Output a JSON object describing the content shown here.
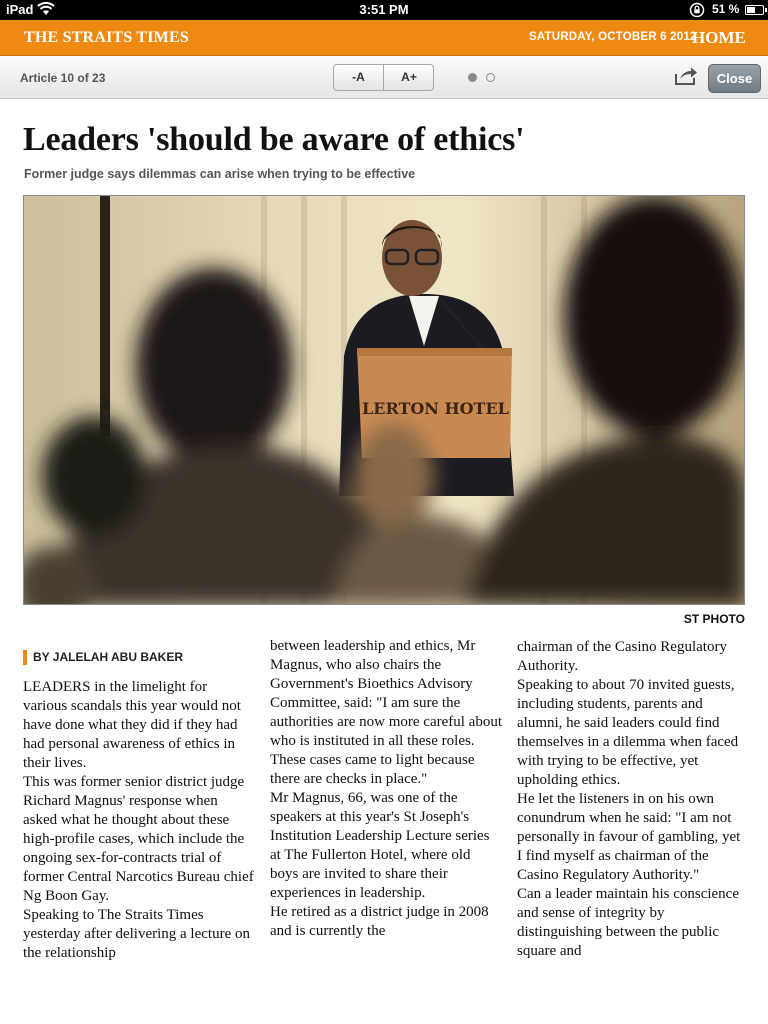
{
  "status_bar": {
    "device": "iPad",
    "time": "3:51 PM",
    "battery_percent": "51 %",
    "battery_level": 0.51
  },
  "masthead": {
    "brand": "THE STRAITS TIMES",
    "date": "SATURDAY, OCTOBER 6 2012",
    "home_label": "HOME",
    "accent_color": "#ee8a12"
  },
  "toolbar": {
    "article_counter": "Article 10 of 23",
    "font_smaller_label": "-A",
    "font_larger_label": "A+",
    "page_indicator": {
      "current": 1,
      "total": 2
    },
    "share_icon": "share-arrow-icon",
    "close_label": "Close"
  },
  "article": {
    "headline": "Leaders 'should be aware of ethics'",
    "standfirst": "Former judge says dilemmas can arise when trying to be effective",
    "photo_credit": "ST PHOTO",
    "photo_podium_text": "LERTON HOTEL",
    "byline": "BY JALELAH ABU BAKER",
    "columns": [
      "LEADERS in the limelight for various scandals this year would not have done what they did if they had had personal awareness of ethics in their lives.\n This was former senior district judge Richard Magnus' response when asked what he thought about these high-profile cases, which include the ongoing sex-for-contracts trial of former Central Narcotics Bureau chief Ng Boon Gay.\n Speaking to The Straits Times yesterday after delivering a lecture on the relationship",
      "between leadership and ethics, Mr Magnus, who also chairs the Government's Bioethics Advisory Committee, said: \"I am sure the authorities are now more careful about who is instituted in all these roles. These cases came to light because there are checks in place.\"\n Mr Magnus, 66, was one of the speakers at this year's St Joseph's Institution Leadership Lecture series at The Fullerton Hotel, where old boys are invited to share their experiences in leadership.\n He retired as a district judge in 2008 and is currently the",
      "chairman of the Casino Regulatory Authority.\n Speaking to about 70 invited guests, including students, parents and alumni, he said leaders could find themselves in a dilemma when faced with trying to be effective, yet upholding ethics.\n He let the listeners in on his own conundrum when he said: \"I am not personally in favour of gambling, yet I find myself as chairman of the Casino Regulatory Authority.\"\n Can a leader maintain his conscience and sense of integrity by distinguishing between the public square and"
    ]
  }
}
